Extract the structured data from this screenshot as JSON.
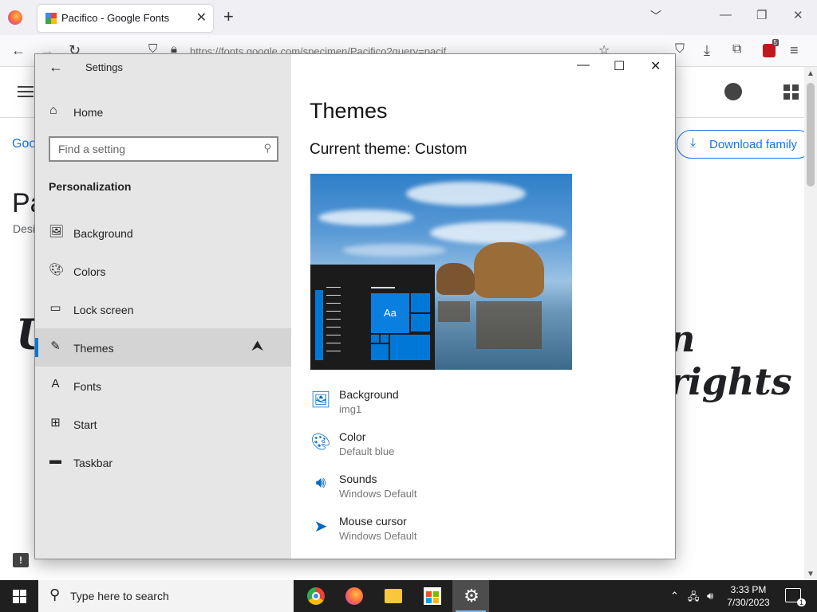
{
  "browser": {
    "tab_title": "Pacifico - Google Fonts",
    "url": "https://fonts.google.com/specimen/Pacifico?query=pacif",
    "extension_badge": "5"
  },
  "background_page": {
    "breadcrumb": "Goo",
    "download_label": "Download family",
    "font_title": "Pa",
    "designer_partial": "Desi",
    "sample_left": "U",
    "sample_right": "n rights"
  },
  "settings": {
    "app_title": "Settings",
    "home_label": "Home",
    "search_placeholder": "Find a setting",
    "section_title": "Personalization",
    "nav_items": [
      {
        "label": "Background",
        "icon": "picture-icon"
      },
      {
        "label": "Colors",
        "icon": "palette-icon"
      },
      {
        "label": "Lock screen",
        "icon": "lock-screen-icon"
      },
      {
        "label": "Themes",
        "icon": "themes-icon",
        "selected": true
      },
      {
        "label": "Fonts",
        "icon": "fonts-icon"
      },
      {
        "label": "Start",
        "icon": "start-icon"
      },
      {
        "label": "Taskbar",
        "icon": "taskbar-icon"
      }
    ],
    "page_title": "Themes",
    "current_theme": "Current theme: Custom",
    "preview_tile_label": "Aa",
    "properties": [
      {
        "title": "Background",
        "value": "img1",
        "icon": "picture-icon"
      },
      {
        "title": "Color",
        "value": "Default blue",
        "icon": "palette-icon"
      },
      {
        "title": "Sounds",
        "value": "Windows Default",
        "icon": "speaker-icon"
      },
      {
        "title": "Mouse cursor",
        "value": "Windows Default",
        "icon": "cursor-icon"
      }
    ]
  },
  "taskbar": {
    "search_placeholder": "Type here to search",
    "apps": [
      "Chrome",
      "Firefox",
      "File Explorer",
      "Microsoft Store",
      "Settings"
    ],
    "time": "3:33 PM",
    "date": "7/30/2023",
    "notification_count": "1"
  },
  "colors": {
    "accent": "#0078d7",
    "taskbar": "#1f1f1f",
    "sidebar": "#e6e6e6"
  }
}
